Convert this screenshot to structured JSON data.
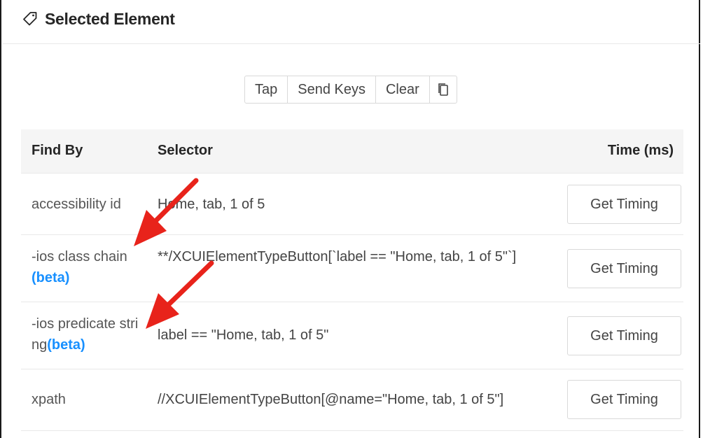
{
  "header": {
    "title": "Selected Element"
  },
  "actions": {
    "tap": "Tap",
    "send_keys": "Send Keys",
    "clear": "Clear"
  },
  "table": {
    "columns": {
      "find_by": "Find By",
      "selector": "Selector",
      "time": "Time (ms)"
    },
    "rows": [
      {
        "find_by": "accessibility id",
        "beta": "",
        "selector": "Home, tab, 1 of 5",
        "button": "Get Timing"
      },
      {
        "find_by": "-ios class chain",
        "beta": "(beta)",
        "selector": "**/XCUIElementTypeButton[`label == \"Home, tab, 1 of 5\"`]",
        "button": "Get Timing"
      },
      {
        "find_by": "-ios predicate string",
        "beta": "(beta)",
        "selector": "label == \"Home, tab, 1 of 5\"",
        "button": "Get Timing"
      },
      {
        "find_by": "xpath",
        "beta": "",
        "selector": "//XCUIElementTypeButton[@name=\"Home, tab, 1 of 5\"]",
        "button": "Get Timing"
      }
    ]
  },
  "colors": {
    "beta": "#1890ff",
    "annotation_arrow": "#e8231b",
    "header_bg": "#f5f5f5"
  },
  "icons": {
    "title": "tag-icon",
    "copy": "copy-icon",
    "annotation": "red-arrow-annotation"
  }
}
